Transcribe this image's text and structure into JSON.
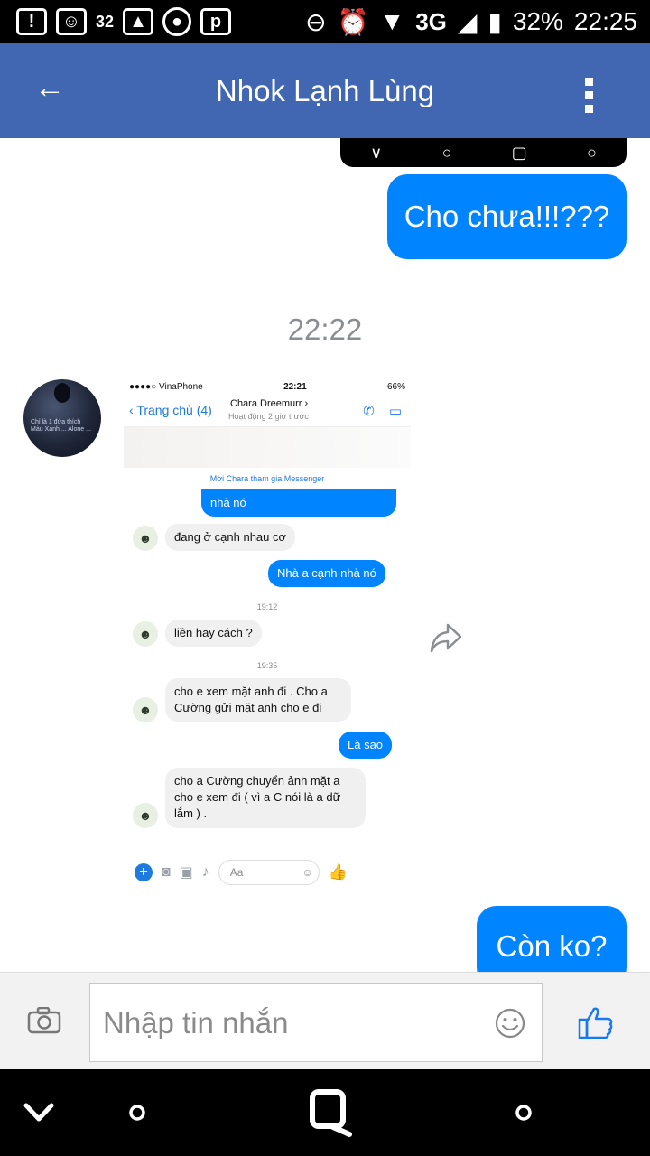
{
  "status_bar": {
    "notif_number": "32",
    "network": "3G",
    "battery": "32%",
    "time": "22:25"
  },
  "header": {
    "title": "Nhok Lạnh Lùng"
  },
  "messages": {
    "sent_1": "Cho chưa!!!???",
    "timestamp": "22:22",
    "sent_2": "Còn ko?"
  },
  "shared_image": {
    "status_carrier": "●●●●○ VinaPhone",
    "status_time": "22:21",
    "status_battery": "66%",
    "back_label": "Trang chủ (4)",
    "contact_name": "Chara Dreemurr",
    "contact_status": "Hoạt động 2 giờ trước",
    "invite_text": "Mời Chara tham gia Messenger",
    "msg_top": "nhà nó",
    "msg_1": "đang ở cạnh nhau cơ",
    "msg_2": "Nhà a cạnh nhà nó",
    "time_1": "19:12",
    "msg_3": "liền hay cách ?",
    "time_2": "19:35",
    "msg_4": "cho e xem mặt anh đi . Cho a Cường gửi mặt anh cho e đi",
    "msg_5": "Là sao",
    "msg_6": "cho a Cường chuyển ảnh mặt a cho e xem đi ( vì a C nói là a dữ lắm ) .",
    "input_placeholder": "Aa",
    "avatar_caption": "Chỉ là 1 đứa thích Màu Xanh ... Alone ..."
  },
  "composer": {
    "placeholder": "Nhập tin nhắn"
  },
  "colors": {
    "header": "#4267b2",
    "bubble": "#0084ff"
  }
}
